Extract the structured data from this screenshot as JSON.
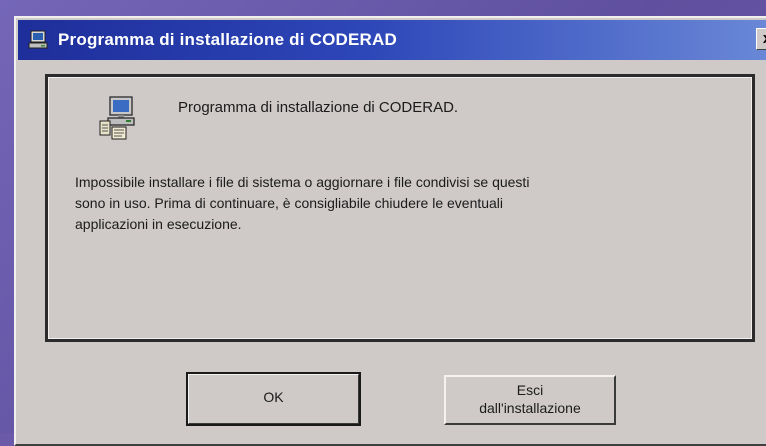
{
  "window": {
    "title": "Programma di installazione di CODERAD",
    "close_glyph": "x"
  },
  "content": {
    "heading": "Programma di installazione di CODERAD.",
    "icon": "installer-computer-icon",
    "message_lines": [
      "Impossibile installare i file di sistema o aggiornare i file condivisi se questi",
      "sono in uso. Prima di continuare, è consigliabile chiudere le eventuali",
      "applicazioni in esecuzione."
    ]
  },
  "buttons": {
    "ok_label": "OK",
    "exit_label_line1": "Esci",
    "exit_label_line2": "dall'installazione"
  },
  "colors": {
    "desktop": "#6a5aa8",
    "title_bar_start": "#1e2e9a",
    "title_bar_end": "#6c8ad8",
    "dialog_face": "#cfcac8"
  }
}
